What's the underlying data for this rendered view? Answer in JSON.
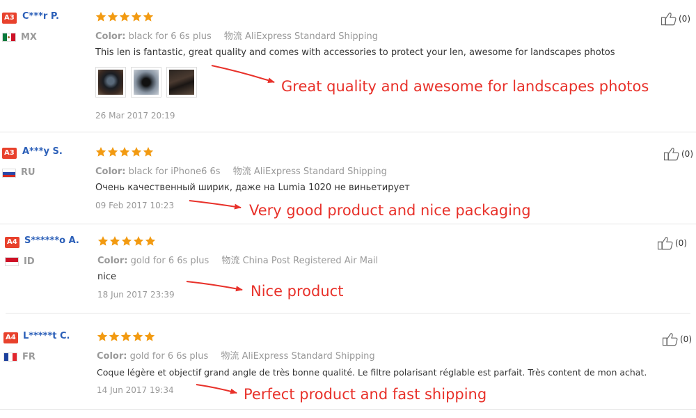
{
  "colors": {
    "accent": "#e8412c",
    "username": "#2b5fb8",
    "star": "#f29a11",
    "annotation": "#e8312a"
  },
  "reviews": [
    {
      "level": "A3",
      "user": "C***r P.",
      "country": "MX",
      "rating": 5,
      "color_label": "Color:",
      "color_value": "black for 6 6s plus",
      "shipping_label": "物流",
      "shipping_value": "AliExpress Standard Shipping",
      "feedback": "This len is fantastic, great quality and comes with accessories to protect your len, awesome for landscapes photos",
      "photos": [
        "photo-1",
        "photo-2",
        "photo-3"
      ],
      "date": "26 Mar 2017 20:19",
      "helpful": "(0)",
      "annotation": "Great quality and awesome for landscapes photos"
    },
    {
      "level": "A3",
      "user": "A***y S.",
      "country": "RU",
      "rating": 5,
      "color_label": "Color:",
      "color_value": "black for iPhone6 6s",
      "shipping_label": "物流",
      "shipping_value": "AliExpress Standard Shipping",
      "feedback": "Очень качественный ширик, даже на Lumia 1020 не виньетирует",
      "date": "09 Feb 2017 10:23",
      "helpful": "(0)",
      "annotation": "Very good product and nice packaging"
    },
    {
      "level": "A4",
      "user": "S******o A.",
      "country": "ID",
      "rating": 5,
      "color_label": "Color:",
      "color_value": "gold for 6 6s plus",
      "shipping_label": "物流",
      "shipping_value": "China Post Registered Air Mail",
      "feedback": "nice",
      "date": "18 Jun 2017 23:39",
      "helpful": "(0)",
      "annotation": "Nice product"
    },
    {
      "level": "A4",
      "user": "L*****t C.",
      "country": "FR",
      "rating": 5,
      "color_label": "Color:",
      "color_value": "gold for 6 6s plus",
      "shipping_label": "物流",
      "shipping_value": "AliExpress Standard Shipping",
      "feedback": "Coque légère et objectif grand angle de très bonne qualité. Le filtre polarisant réglable est parfait. Très content de mon achat.",
      "date": "14 Jun 2017 19:34",
      "helpful": "(0)",
      "annotation": "Perfect product and fast shipping"
    }
  ]
}
